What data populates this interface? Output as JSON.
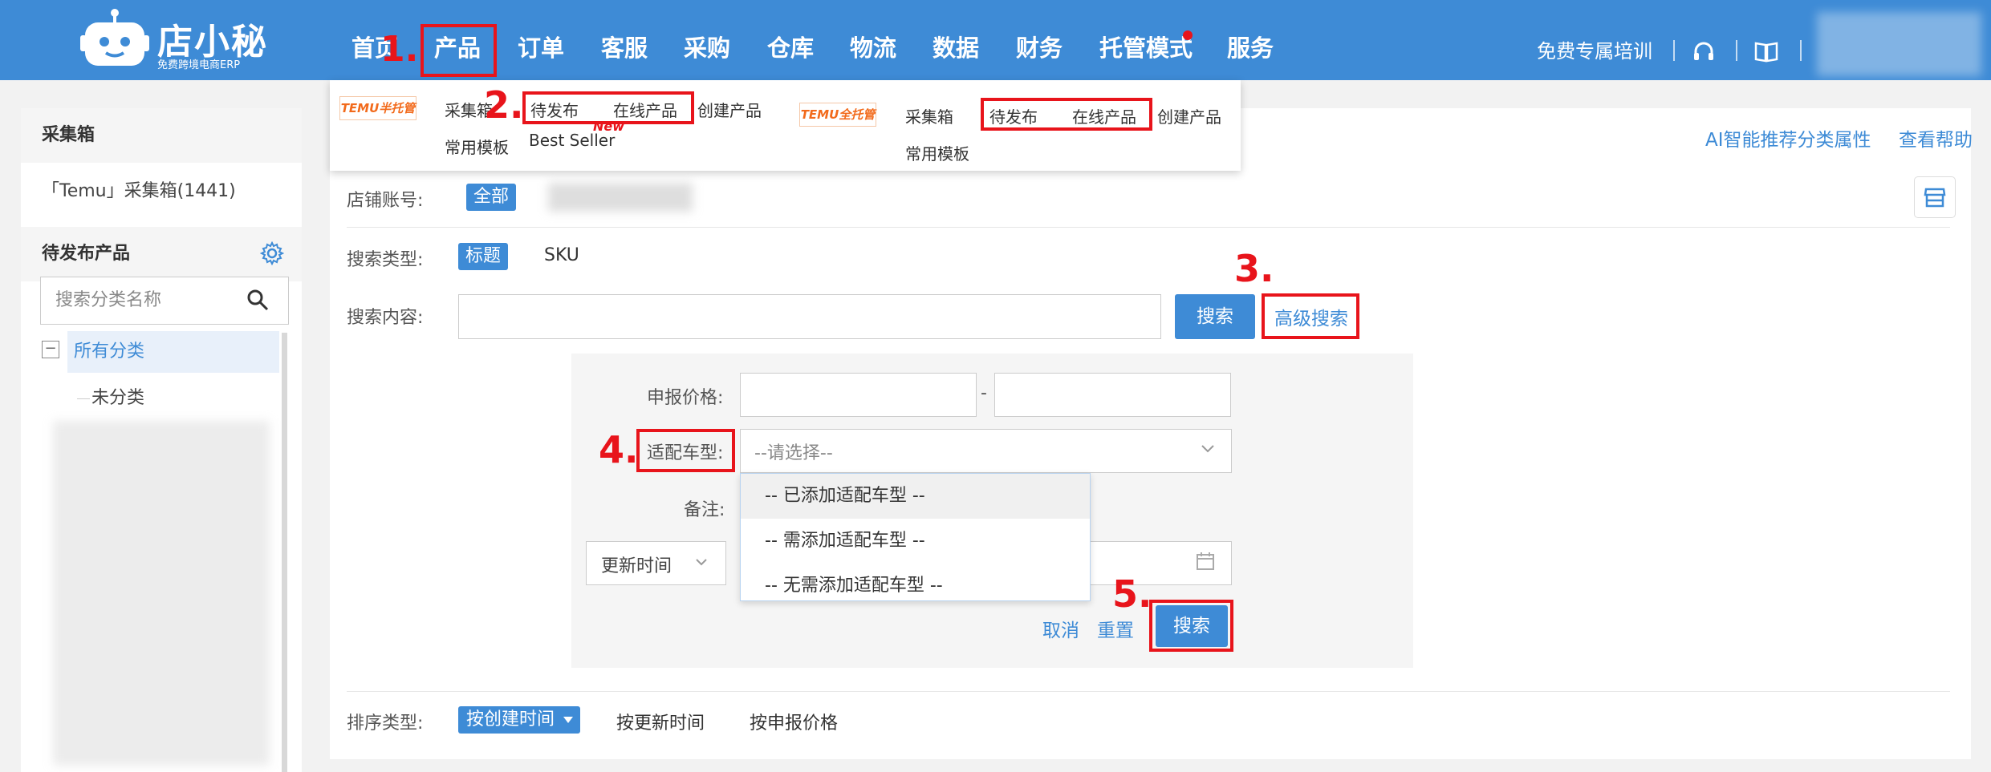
{
  "nav": {
    "logo_text": "店小秘",
    "logo_sub": "免费跨境电商ERP",
    "items": [
      "首页",
      "产品",
      "订单",
      "客服",
      "采购",
      "仓库",
      "物流",
      "数据",
      "财务",
      "托管模式",
      "服务"
    ],
    "training": "免费专属培训",
    "separator": "|"
  },
  "steps": [
    "1.",
    "2.",
    "3.",
    "4.",
    "5."
  ],
  "product_menu": {
    "semi": {
      "logo": "TEMU半托管",
      "collect": "采集箱",
      "pending": "待发布",
      "online": "在线产品",
      "create": "创建产品",
      "templates": "常用模板",
      "bestseller": "Best Seller",
      "new_badge": "New"
    },
    "full": {
      "logo": "TEMU全托管",
      "collect": "采集箱",
      "pending": "待发布",
      "online": "在线产品",
      "create": "创建产品",
      "templates": "常用模板"
    }
  },
  "header_links": {
    "ai": "AI智能推荐分类属性",
    "help": "查看帮助"
  },
  "sidebar": {
    "collect_title": "采集箱",
    "collect_item": "「Temu」采集箱(1441)",
    "pending_title": "待发布产品",
    "search_placeholder": "搜索分类名称",
    "tree_expander": "−",
    "tree_all": "所有分类",
    "tree_uncat": "未分类"
  },
  "filters": {
    "shop_label": "店铺账号:",
    "shop_all": "全部",
    "search_type_label": "搜索类型:",
    "type_title": "标题",
    "type_sku": "SKU",
    "search_content_label": "搜索内容:",
    "search_btn": "搜索",
    "advanced": "高级搜索"
  },
  "advanced": {
    "price_label": "申报价格:",
    "price_dash": "-",
    "car_label": "适配车型:",
    "car_placeholder": "--请选择--",
    "remark_label": "备注:",
    "time_select": "更新时间",
    "options": [
      "-- 已添加适配车型 --",
      "-- 需添加适配车型 --",
      "-- 无需添加适配车型 --"
    ],
    "cancel": "取消",
    "reset": "重置",
    "search": "搜索"
  },
  "sort": {
    "label": "排序类型:",
    "by_create": "按创建时间",
    "by_update": "按更新时间",
    "by_price": "按申报价格"
  },
  "colors": {
    "primary": "#3e8bd6",
    "annotation": "#e8141b"
  }
}
